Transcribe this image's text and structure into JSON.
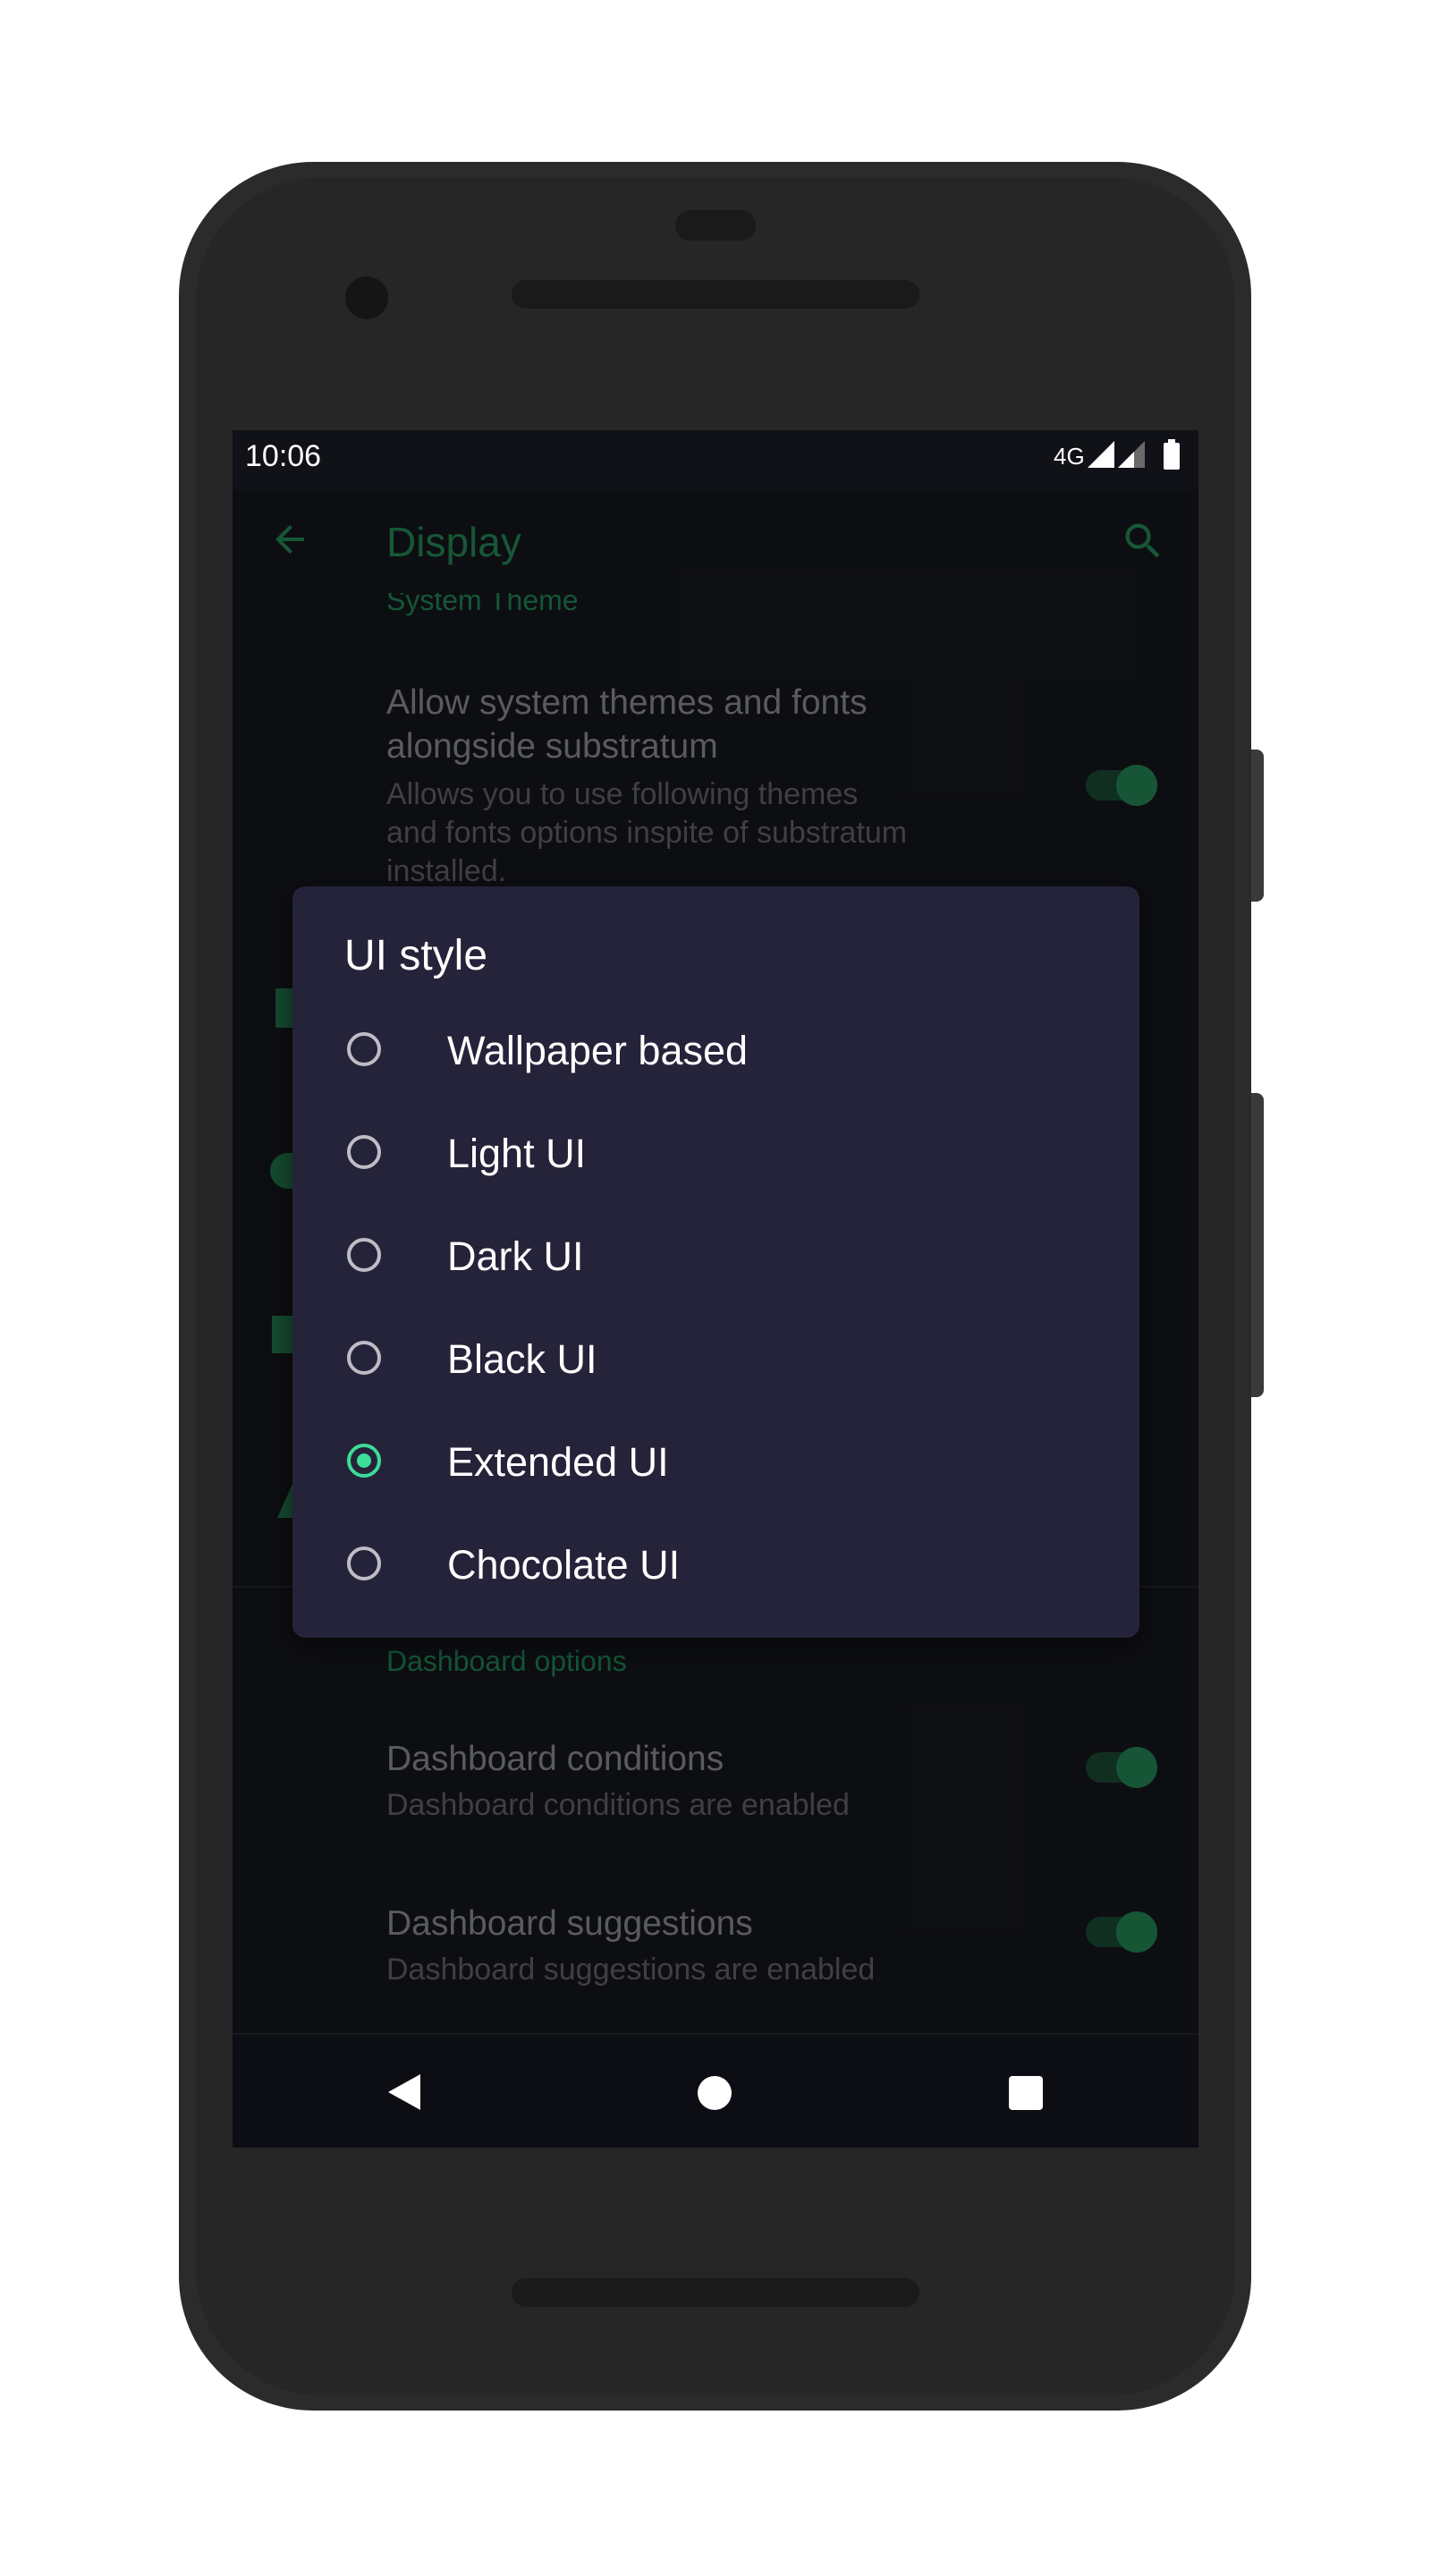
{
  "status_bar": {
    "time": "10:06",
    "network": "4G"
  },
  "app_bar": {
    "title": "Display",
    "back_icon": "arrow-back-icon",
    "search_icon": "search-icon"
  },
  "settings": {
    "system_theme": {
      "header": "System Theme",
      "title": "Allow system themes and fonts alongside substratum",
      "title_line1": "Allow system themes and fonts",
      "title_line2": "alongside substratum",
      "subtitle_line1": "Allows you to use following themes",
      "subtitle_line2": "and fonts options inspite of substratum",
      "subtitle_line3": "installed.",
      "enabled": true
    },
    "dashboard": {
      "header": "Dashboard options",
      "items": [
        {
          "title": "Dashboard conditions",
          "subtitle": "Dashboard conditions are enabled",
          "enabled": true
        },
        {
          "title": "Dashboard suggestions",
          "subtitle": "Dashboard suggestions are enabled",
          "enabled": true
        }
      ]
    }
  },
  "dialog": {
    "title": "UI style",
    "options": [
      {
        "label": "Wallpaper based",
        "selected": false
      },
      {
        "label": "Light UI",
        "selected": false
      },
      {
        "label": "Dark UI",
        "selected": false
      },
      {
        "label": "Black UI",
        "selected": false
      },
      {
        "label": "Extended UI",
        "selected": true
      },
      {
        "label": "Chocolate UI",
        "selected": false
      }
    ]
  },
  "nav_bar": {
    "back": "back-triangle-icon",
    "home": "home-circle-icon",
    "recents": "recents-square-icon"
  },
  "colors": {
    "accent": "#3ddc97",
    "dim_accent": "#1d6b44",
    "dialog_bg": "#252339",
    "screen_bg": "#111217"
  }
}
